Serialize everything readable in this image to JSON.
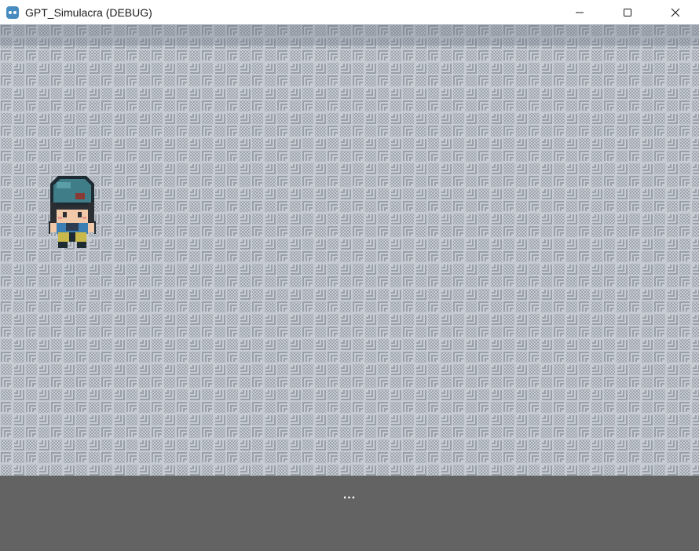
{
  "window": {
    "title": "GPT_Simulacra (DEBUG)",
    "app_icon": "godot-engine-icon",
    "controls": [
      "minimize-icon",
      "maximize-icon",
      "close-icon"
    ]
  },
  "game": {
    "floor_tile": "gray-patterned-floor",
    "character": "player-character-teal-cap",
    "character_facing": "down"
  },
  "dialogue": {
    "text": "..."
  },
  "colors": {
    "floor_light": "#c7ccd3",
    "floor_dark": "#9aa0aa",
    "panel": "#636363",
    "cap": "#3f7d88",
    "pants": "#c9b94a"
  }
}
